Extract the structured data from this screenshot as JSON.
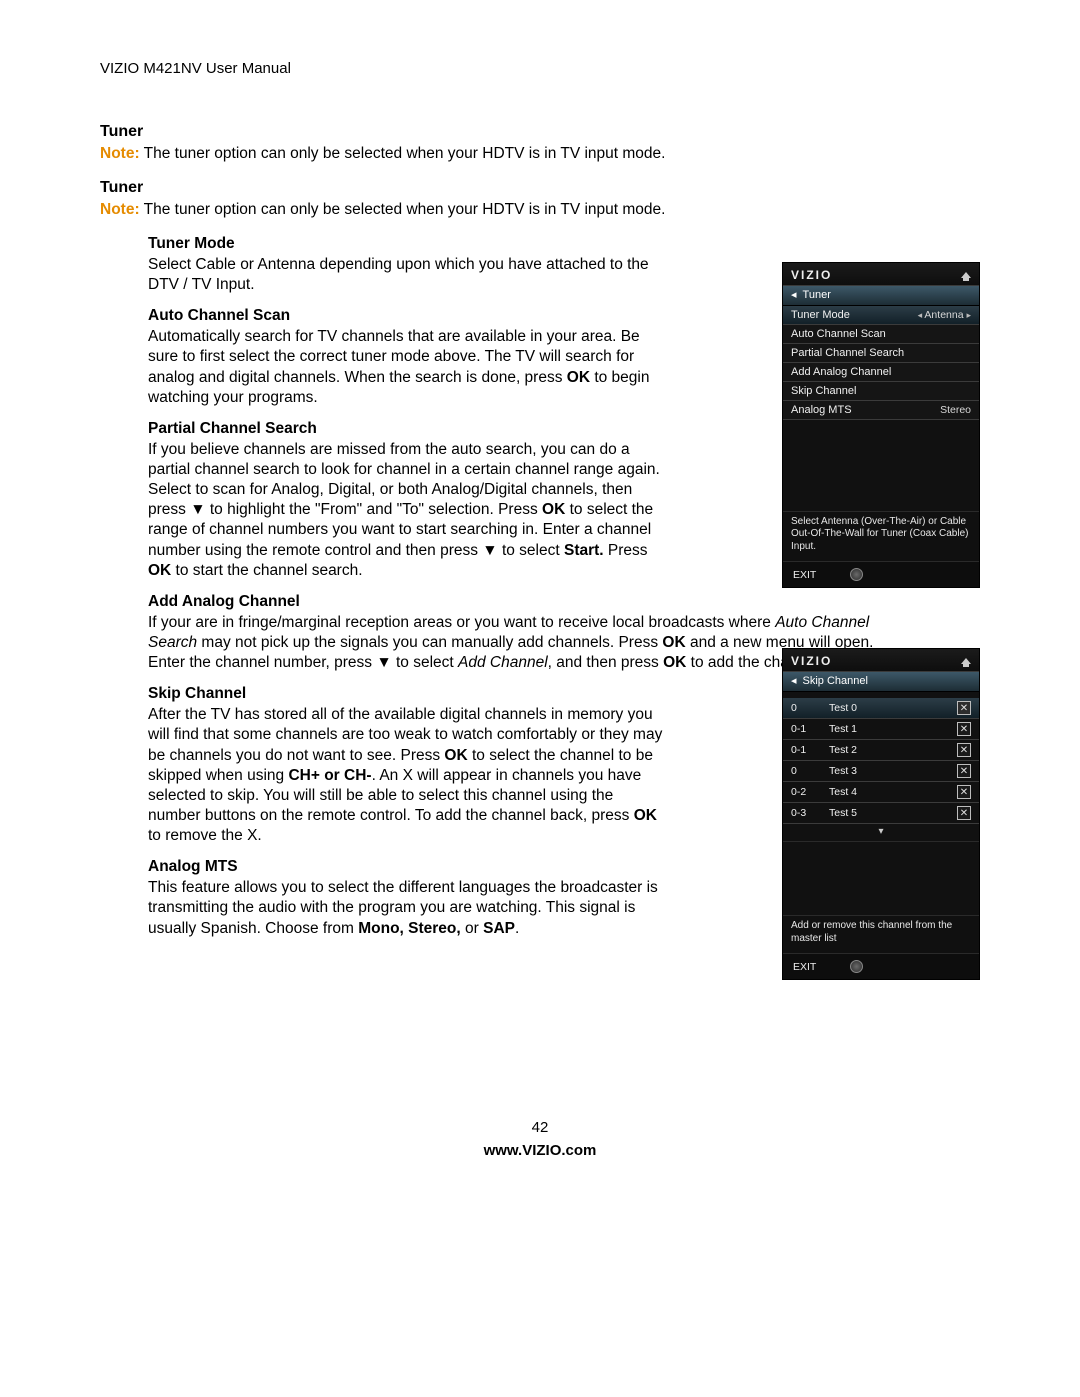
{
  "header": "VIZIO M421NV User Manual",
  "sections": {
    "tuner1": {
      "title": "Tuner",
      "note_label": "Note:",
      "note_text": " The tuner option can only be selected when your HDTV is in TV input mode."
    },
    "tuner2": {
      "title": "Tuner",
      "note_label": "Note:",
      "note_text": " The tuner option can only be selected when your HDTV is in TV input mode."
    },
    "tuner_mode": {
      "title": "Tuner Mode",
      "body": "Select Cable or Antenna depending upon which you have attached to the DTV / TV Input."
    },
    "auto_scan": {
      "title": "Auto Channel Scan",
      "body_pre": "Automatically search for TV channels that are available in your area. Be sure to first select the correct tuner mode above. The TV will search for analog and digital channels. When the search is done, press ",
      "ok": "OK",
      "body_post": " to begin watching your programs."
    },
    "partial": {
      "title": "Partial Channel Search",
      "p1": "If you believe channels are missed from the auto search, you can do a partial channel search to look for channel in a certain channel range again. Select to scan for Analog, Digital, or both Analog/Digital channels, then press ▼ to highlight the \"From\" and \"To\" selection. Press ",
      "ok1": "OK",
      "p2": " to select the range of channel numbers you want to start searching in. Enter a channel number using the remote control and then press ▼ to select ",
      "start": "Start.",
      "p3": " Press ",
      "ok2": "OK",
      "p4": " to start the channel search."
    },
    "add_analog": {
      "title": "Add Analog Channel",
      "l1a": "If your are in fringe/marginal reception areas or you want to receive local broadcasts where ",
      "l1i": "Auto Channel Search",
      "l1b": " may not pick up the signals you can manually add channels. Press ",
      "ok1": "OK",
      "l1c": " and a new menu will open. Enter the channel number, press ▼ to select ",
      "addch": "Add Channel",
      "l1d": ", and then press ",
      "ok2": "OK",
      "l1e": " to add the channel."
    },
    "skip": {
      "title": "Skip Channel",
      "p1": "After the TV has stored all of the available digital channels in memory you will find that some channels are too weak to watch comfortably or they may be channels you do not want to see. Press ",
      "ok1": "OK",
      "p2": " to select the channel to be skipped when using ",
      "chpm": "CH+ or CH-",
      "p3": ". An X will appear in channels you have selected to skip. You will still be able to select this channel using the number buttons on the remote control. To add the channel back, press ",
      "ok2": "OK",
      "p4": " to remove the X."
    },
    "analog_mts": {
      "title": "Analog MTS",
      "p1": "This feature allows you to select the different languages the broadcaster is transmitting the audio with the program you are watching. This signal is usually Spanish. Choose from ",
      "bold": "Mono, Stereo,",
      "p2": " or ",
      "sap": "SAP",
      "p3": "."
    }
  },
  "footer": {
    "page_num": "42",
    "url": "www.VIZIO.com"
  },
  "osd1": {
    "logo": "VIZIO",
    "crumb_arrow": "◂",
    "crumb": "Tuner",
    "items": [
      {
        "label": "Tuner Mode",
        "value": "Antenna",
        "show_arrows": true,
        "selected": true
      },
      {
        "label": "Auto Channel Scan"
      },
      {
        "label": "Partial Channel Search"
      },
      {
        "label": "Add Analog Channel"
      },
      {
        "label": "Skip Channel"
      },
      {
        "label": "Analog MTS",
        "value": "Stereo"
      }
    ],
    "help": "Select Antenna (Over-The-Air) or Cable Out-Of-The-Wall for Tuner (Coax Cable) Input.",
    "exit": "EXIT"
  },
  "osd2": {
    "logo": "VIZIO",
    "crumb_arrow": "◂",
    "crumb": "Skip Channel",
    "rows": [
      {
        "num": "0",
        "name": "Test 0",
        "selected": true,
        "x": true
      },
      {
        "num": "0-1",
        "name": "Test 1",
        "x": true
      },
      {
        "num": "0-1",
        "name": "Test 2",
        "x": true
      },
      {
        "num": "0",
        "name": "Test 3",
        "x": true
      },
      {
        "num": "0-2",
        "name": "Test 4",
        "x": true
      },
      {
        "num": "0-3",
        "name": "Test 5",
        "x": true
      }
    ],
    "more": "▾",
    "help": "Add or remove this channel from the master list",
    "exit": "EXIT"
  }
}
